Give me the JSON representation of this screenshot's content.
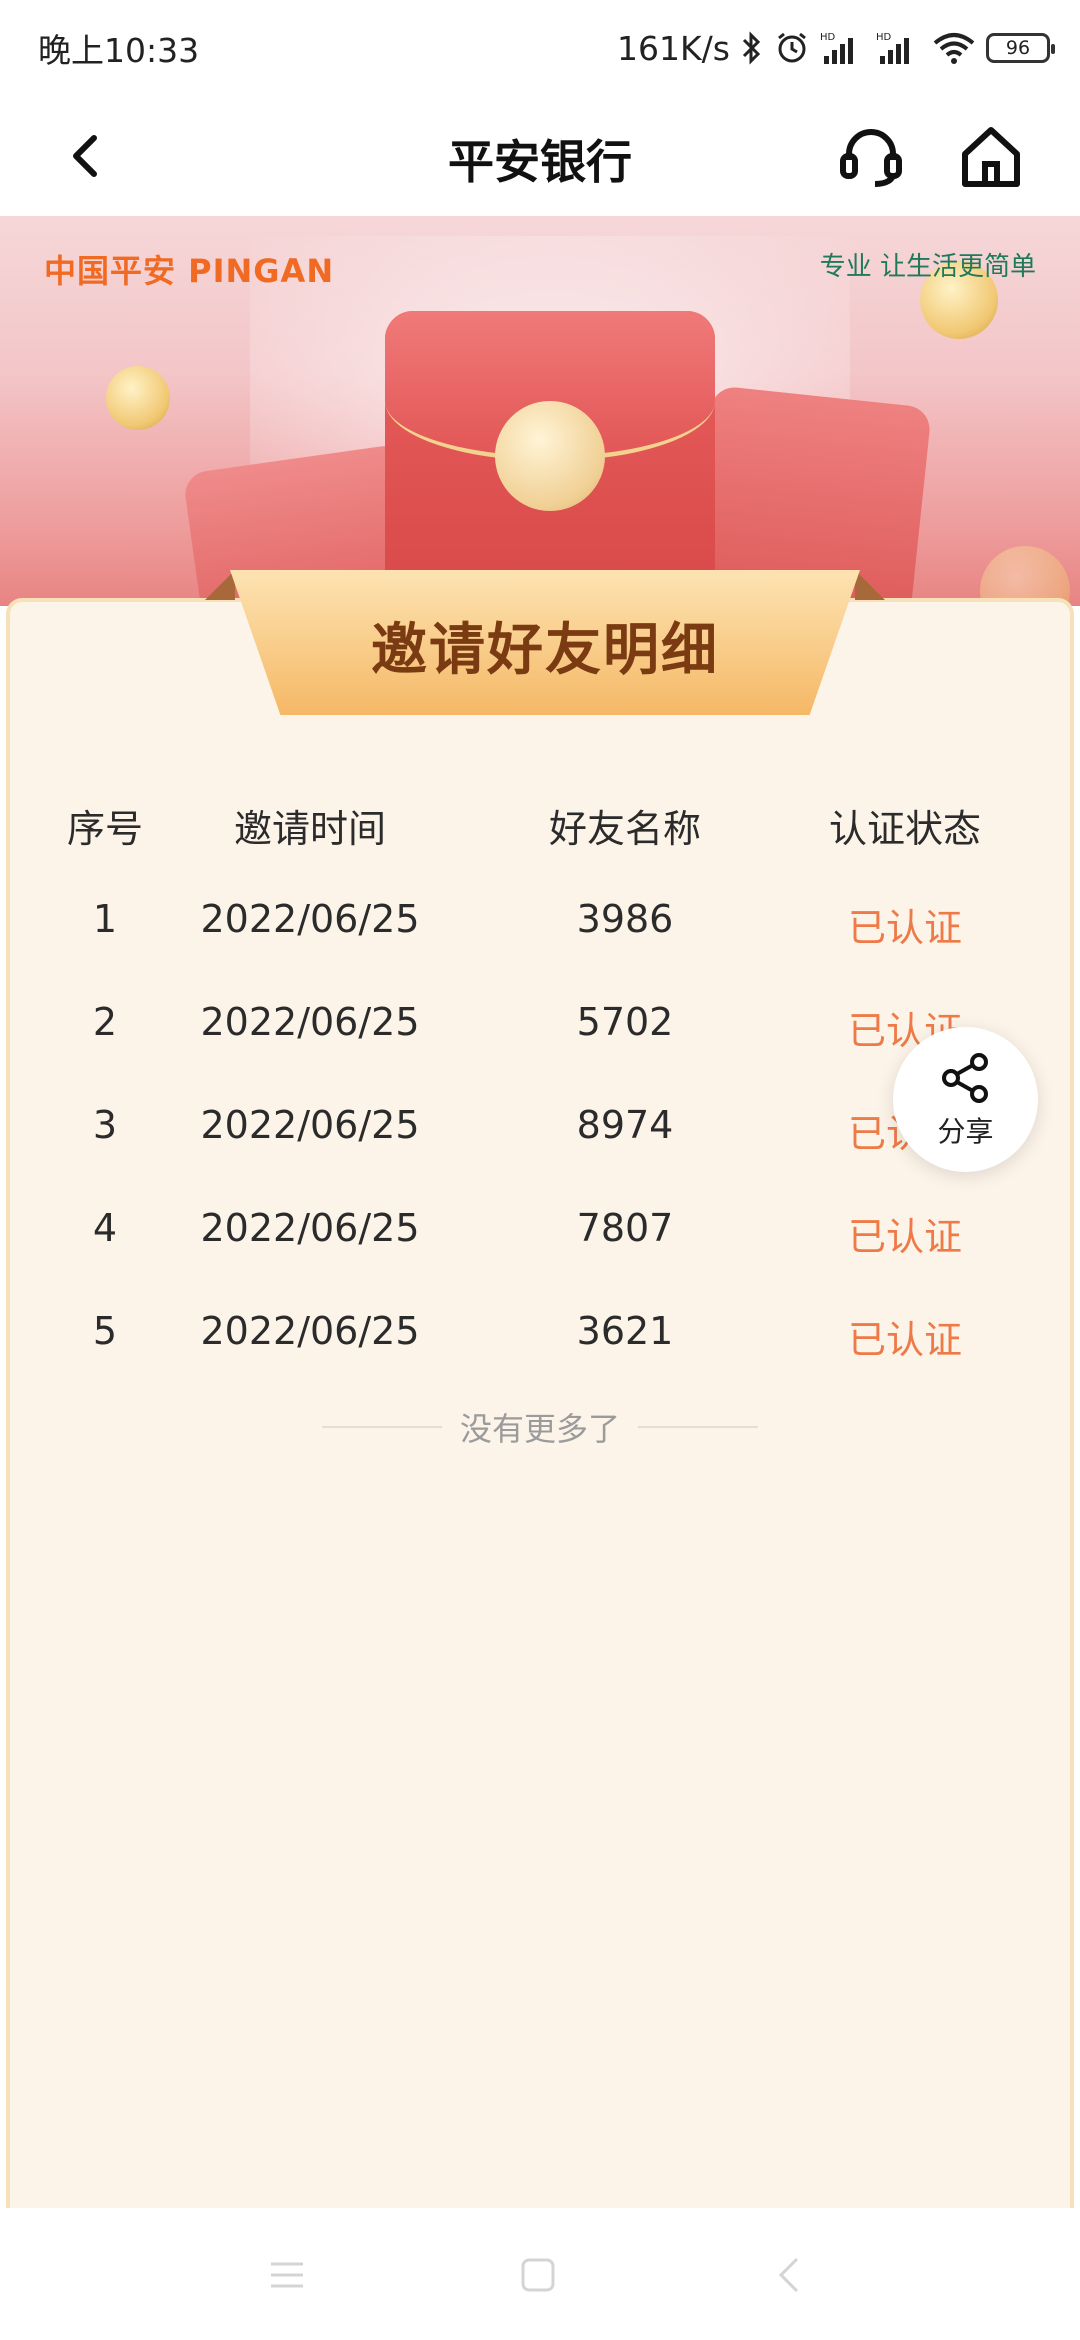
{
  "status_bar": {
    "time": "晚上10:33",
    "net_speed": "161K/s",
    "battery": "96"
  },
  "nav": {
    "title": "平安银行"
  },
  "banner": {
    "brand": "中国平安 PINGAN",
    "slogan": "专业 让生活更简单"
  },
  "card": {
    "title": "邀请好友明细"
  },
  "table": {
    "headers": [
      "序号",
      "邀请时间",
      "好友名称",
      "认证状态"
    ],
    "rows": [
      {
        "no": "1",
        "time": "2022/06/25",
        "name": "3986",
        "status": "已认证"
      },
      {
        "no": "2",
        "time": "2022/06/25",
        "name": "5702",
        "status": "已认证"
      },
      {
        "no": "3",
        "time": "2022/06/25",
        "name": "8974",
        "status": "已认证"
      },
      {
        "no": "4",
        "time": "2022/06/25",
        "name": "7807",
        "status": "已认证"
      },
      {
        "no": "5",
        "time": "2022/06/25",
        "name": "3621",
        "status": "已认证"
      }
    ]
  },
  "footer_note": "没有更多了",
  "share": {
    "label": "分享"
  },
  "colors": {
    "accent_status": "#ee7a47",
    "card_bg": "#fcf4e9",
    "title_brown": "#7a3b12"
  }
}
